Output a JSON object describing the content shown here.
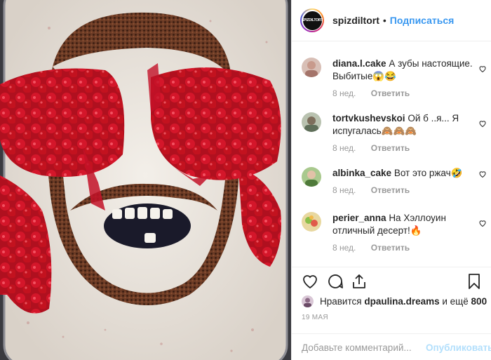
{
  "post": {
    "username": "spizdiltort",
    "separator": "•",
    "follow_label": "Подписаться",
    "avatar_text": "SPIZDILTORT",
    "photo_icon": "cake-face-photo"
  },
  "comments": [
    {
      "username": "diana.l.cake",
      "text": "А зубы настоящие. Выбитые😱😂",
      "time": "8 нед.",
      "reply_label": "Ответить",
      "avatar_color": "#c9a39a"
    },
    {
      "username": "tortvkushevskoi",
      "text": "Ой б ..я... Я испугалась🙈🙈🙈",
      "time": "8 нед.",
      "reply_label": "Ответить",
      "avatar_color": "#8e9a88"
    },
    {
      "username": "albinka_cake",
      "text": "Вот это ржач🤣",
      "time": "8 нед.",
      "reply_label": "Ответить",
      "avatar_color": "#7fa36a"
    },
    {
      "username": "perier_anna",
      "text": "На Хэллоуин отличный десерт!🔥",
      "time": "8 нед.",
      "reply_label": "Ответить",
      "avatar_color": "#9fc36b"
    }
  ],
  "actions": {
    "icons": [
      "heart-icon",
      "comment-icon",
      "share-icon",
      "bookmark-icon"
    ]
  },
  "likes": {
    "prefix": "Нравится ",
    "user": "dpaulina.dreams",
    "middle": " и ещё ",
    "count": "800"
  },
  "date": "19 МАЯ",
  "add_comment": {
    "placeholder": "Добавьте комментарий...",
    "publish_label": "Опубликовать"
  }
}
